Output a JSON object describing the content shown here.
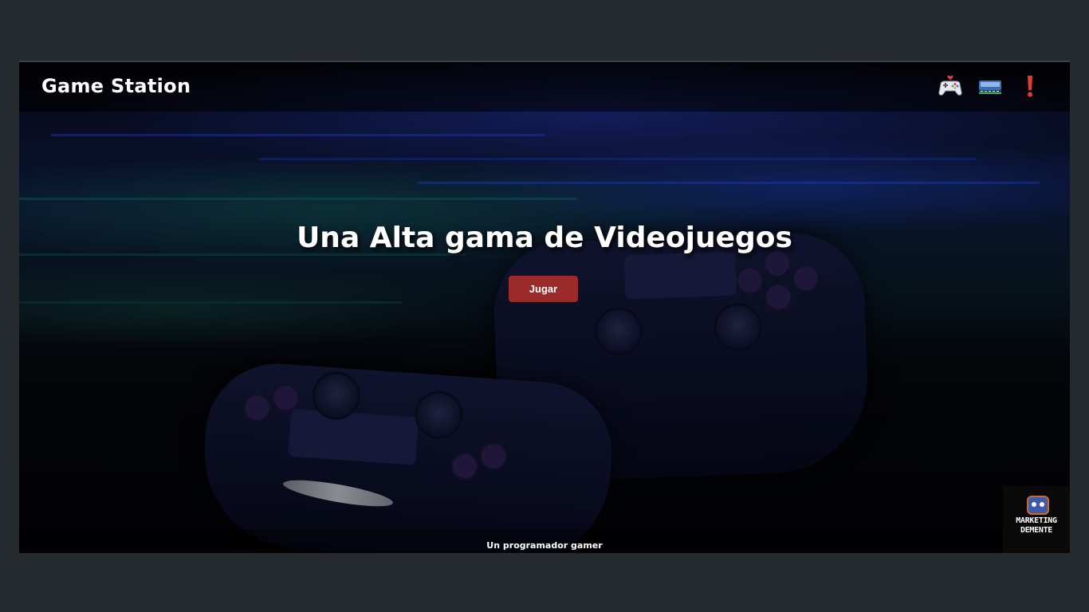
{
  "header": {
    "brand": "Game Station",
    "icons": [
      "gamepad-heart-icon",
      "retro-console-icon",
      "exclamation-icon"
    ]
  },
  "hero": {
    "title": "Una Alta gama de Videojuegos",
    "cta_label": "Jugar",
    "cta_color": "#9b2a2a"
  },
  "footer": {
    "text": "Un programador gamer"
  },
  "logo": {
    "line1": "MARKETING",
    "line2": "DEMENTE"
  },
  "colors": {
    "page_background": "#242a2e",
    "accent_red": "#e23b3b"
  }
}
